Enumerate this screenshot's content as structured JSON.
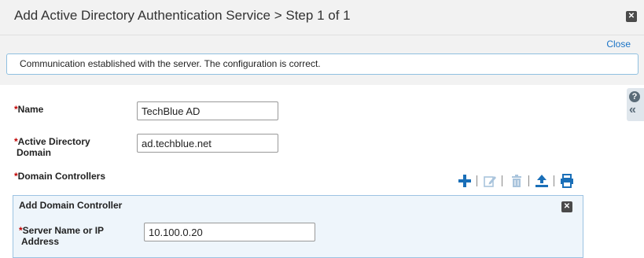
{
  "dialog": {
    "title": "Add Active Directory Authentication Service > Step 1 of 1",
    "close_link": "Close",
    "close_icon_glyph": "✕"
  },
  "message": {
    "text": "Communication established with the server. The configuration is correct."
  },
  "side_tab": {
    "help_glyph": "?",
    "collapse_glyph": "«"
  },
  "form": {
    "required_marker": "*",
    "name": {
      "label": "Name",
      "value": "TechBlue AD"
    },
    "domain": {
      "label_line1": "Active Directory",
      "label_line2": "Domain",
      "value": "ad.techblue.net"
    },
    "controllers": {
      "label": "Domain Controllers"
    }
  },
  "toolbar": {
    "icons": [
      "add-icon",
      "edit-icon",
      "delete-icon",
      "upload-icon",
      "print-icon"
    ],
    "colors": {
      "active": "#1a6fb8",
      "disabled": "#a9c4dc"
    }
  },
  "add_controller_panel": {
    "title": "Add Domain Controller",
    "close_glyph": "✕",
    "server": {
      "label_line1": "Server Name or IP",
      "label_line2": "Address",
      "value": "10.100.0.20"
    }
  }
}
